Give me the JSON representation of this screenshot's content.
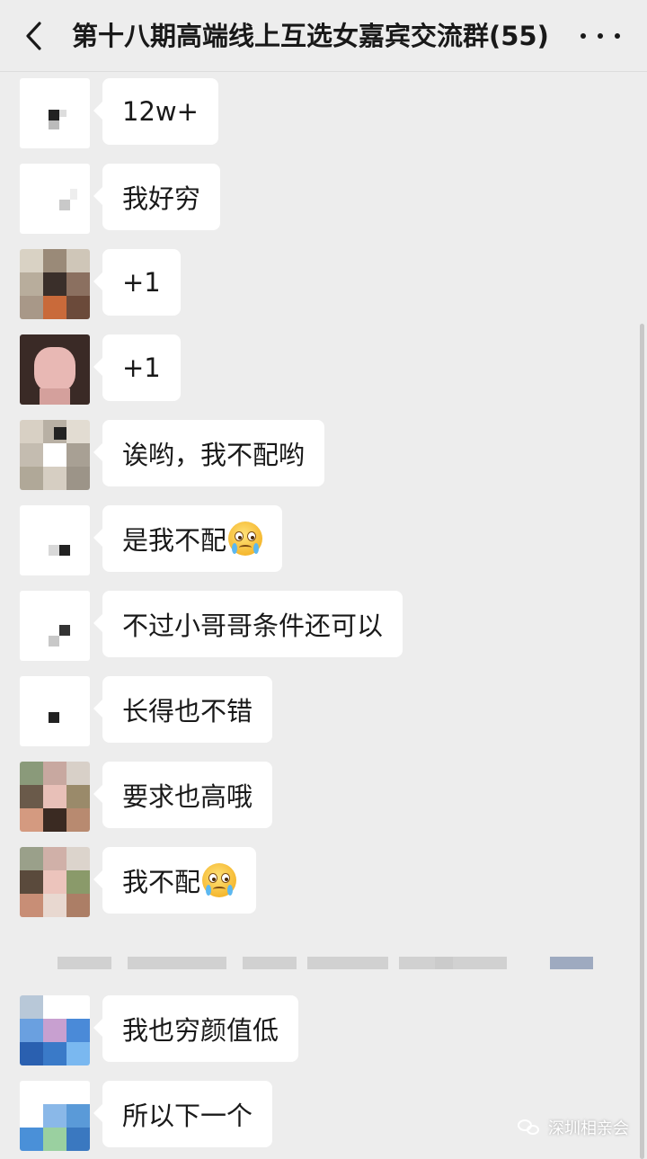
{
  "header": {
    "title": "第十八期高端线上互选女嘉宾交流群(55)",
    "back_icon": "chevron-left-icon",
    "more_icon": "more-dots-icon"
  },
  "messages": [
    {
      "text": "12w+"
    },
    {
      "text": "我好穷"
    },
    {
      "text": "+1"
    },
    {
      "text": "+1"
    },
    {
      "text": "诶哟，我不配哟"
    },
    {
      "text": "是我不配",
      "emoji": "crying-face-emoji"
    },
    {
      "text": "不过小哥哥条件还可以"
    },
    {
      "text": "长得也不错"
    },
    {
      "text": "要求也高哦"
    },
    {
      "text": "我不配",
      "emoji": "crying-face-emoji"
    },
    {
      "text": "我也穷颜值低"
    },
    {
      "text": "所以下一个"
    }
  ],
  "watermark": {
    "text": "深圳相亲会",
    "icon": "wechat-icon"
  },
  "colors": {
    "background": "#ededed",
    "bubble": "#ffffff",
    "text": "#191919"
  }
}
